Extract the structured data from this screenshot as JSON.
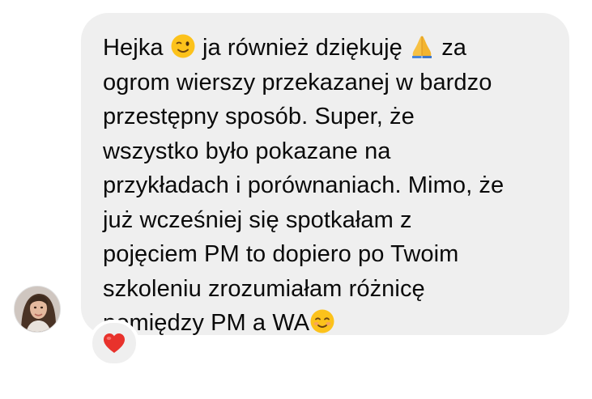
{
  "message": {
    "lines": [
      "Hejka ",
      " ja również dziękuję ",
      " za",
      "ogrom wierszy przekazanej w bardzo",
      "przestępny sposób. Super, że",
      "wszystko było pokazane na",
      "przykładach i porównaniach. Mimo, że",
      "już wcześniej się spotkałam z",
      "pojęciem PM to dopiero po Twoim",
      "szkoleniu zrozumiałam różnicę",
      "pomiędzy PM a WA"
    ],
    "icons": [
      "winking-face-icon",
      "folded-hands-icon",
      "smiling-face-icon"
    ]
  },
  "sender": {
    "avatar_icon": "profile-photo-avatar"
  },
  "reaction": {
    "icon": "red-heart-icon"
  },
  "colors": {
    "bubble": "#efefef",
    "text": "#0a0a0a",
    "background": "#ffffff",
    "heart": "#e8322c"
  }
}
